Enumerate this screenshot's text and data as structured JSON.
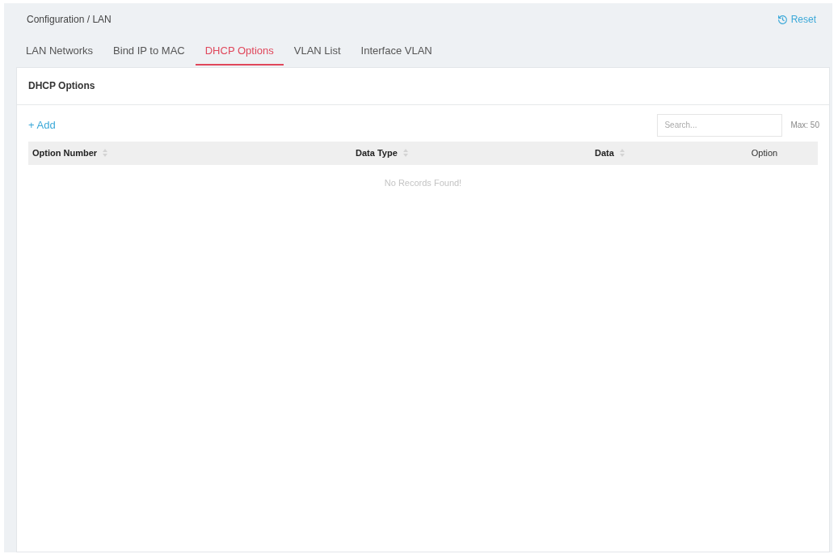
{
  "breadcrumb": "Configuration / LAN",
  "reset": {
    "label": "Reset"
  },
  "tabs": [
    {
      "label": "LAN Networks",
      "selected": false
    },
    {
      "label": "Bind IP to MAC",
      "selected": false
    },
    {
      "label": "DHCP Options",
      "selected": true
    },
    {
      "label": "VLAN List",
      "selected": false
    },
    {
      "label": "Interface VLAN",
      "selected": false
    }
  ],
  "panel": {
    "title": "DHCP Options",
    "add": {
      "label": "+ Add"
    },
    "search": {
      "placeholder": "Search..."
    },
    "limit": "Max: 50",
    "table": {
      "columns": [
        {
          "label": "Option Number",
          "sortable": true
        },
        {
          "label": "Data Type",
          "sortable": true
        },
        {
          "label": "Data",
          "sortable": true
        },
        {
          "label": "Option",
          "sortable": false
        }
      ],
      "empty_message": "No Records Found!"
    }
  }
}
